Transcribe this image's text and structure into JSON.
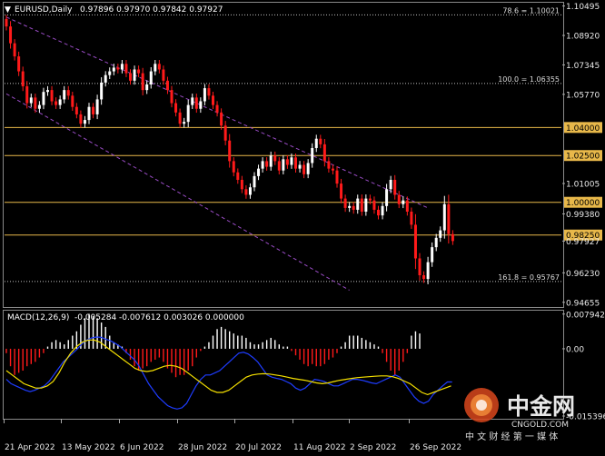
{
  "chart_data": [
    {
      "type": "candlestick",
      "symbol": "EURUSD,Daily",
      "ohlc_header": "0.97896 0.97970 0.97842 0.97927",
      "y_ticks": [
        "1.10495",
        "1.08920",
        "1.07345",
        "1.05770",
        "1.04000",
        "1.02500",
        "1.01005",
        "1.00000",
        "0.99380",
        "0.98250",
        "0.97927",
        "0.96230",
        "0.94655"
      ],
      "y_range": [
        0.9445,
        1.1062
      ],
      "x_labels": [
        "21 Apr 2022",
        "13 May 2022",
        "6 Jun 2022",
        "28 Jun 2022",
        "20 Jul 2022",
        "11 Aug 2022",
        "2 Sep 2022",
        "26 Sep 2022"
      ],
      "horizontal_levels": [
        1.04,
        1.025,
        1.0,
        0.9825
      ],
      "fib_levels": [
        {
          "label": "78.6 = 1.10021",
          "price": 1.10021
        },
        {
          "label": "100.0 = 1.06355",
          "price": 1.06355
        },
        {
          "label": "161.8 = 0.95767",
          "price": 0.95767
        }
      ],
      "channel": {
        "upper": [
          [
            0,
            1.099
          ],
          [
            102,
            0.997
          ]
        ],
        "lower": [
          [
            0,
            1.058
          ],
          [
            83,
            0.953
          ]
        ]
      },
      "closes": [
        1.094,
        1.085,
        1.078,
        1.07,
        1.062,
        1.053,
        1.056,
        1.05,
        1.052,
        1.059,
        1.06,
        1.054,
        1.052,
        1.055,
        1.06,
        1.057,
        1.051,
        1.047,
        1.042,
        1.044,
        1.051,
        1.047,
        1.055,
        1.064,
        1.068,
        1.07,
        1.072,
        1.071,
        1.074,
        1.069,
        1.065,
        1.071,
        1.069,
        1.06,
        1.063,
        1.07,
        1.074,
        1.071,
        1.065,
        1.06,
        1.053,
        1.048,
        1.042,
        1.043,
        1.052,
        1.056,
        1.05,
        1.054,
        1.061,
        1.057,
        1.052,
        1.048,
        1.041,
        1.033,
        1.022,
        1.016,
        1.012,
        1.007,
        1.004,
        1.008,
        1.014,
        1.018,
        1.022,
        1.019,
        1.025,
        1.022,
        1.017,
        1.023,
        1.02,
        1.024,
        1.018,
        1.02,
        1.015,
        1.021,
        1.029,
        1.034,
        1.031,
        1.022,
        1.018,
        1.017,
        1.01,
        1.002,
        0.997,
        0.998,
        0.996,
        1.002,
        0.995,
        1.002,
        1.001,
        0.996,
        0.993,
        0.998,
        1.007,
        1.012,
        1.004,
        0.999,
        1.001,
        0.995,
        0.988,
        0.97,
        0.961,
        0.959,
        0.968,
        0.976,
        0.981,
        0.985,
        0.999,
        0.983,
        0.9793
      ],
      "macd": {
        "label": "MACD(12,26,9)",
        "values_text": "-0.005284 -0.007612 0.003026 0.000000",
        "y_ticks": [
          "0.007942",
          "0.00",
          "-0.015396"
        ],
        "y_range": [
          -0.0154,
          0.0081
        ],
        "histogram": [
          -0.001,
          -0.004,
          -0.006,
          -0.0055,
          -0.005,
          -0.004,
          -0.0035,
          -0.003,
          -0.002,
          -0.001,
          0.0005,
          0.0015,
          0.002,
          0.0015,
          0.001,
          0.002,
          0.003,
          0.004,
          0.0055,
          0.007,
          0.008,
          0.0075,
          0.007,
          0.006,
          0.005,
          0.003,
          0.0015,
          0.001,
          0.0005,
          -0.001,
          -0.0025,
          -0.004,
          -0.005,
          -0.0045,
          -0.004,
          -0.003,
          -0.0025,
          -0.002,
          -0.003,
          -0.0045,
          -0.0055,
          -0.0065,
          -0.006,
          -0.006,
          -0.005,
          -0.004,
          -0.002,
          -0.0005,
          0.0005,
          0.0015,
          0.003,
          0.0045,
          0.005,
          0.0045,
          0.004,
          0.0035,
          0.003,
          0.003,
          0.0025,
          0.0015,
          0.001,
          0.001,
          0.0015,
          0.002,
          0.0025,
          0.002,
          0.001,
          0.0005,
          0.0005,
          -0.0005,
          -0.0015,
          -0.0025,
          -0.0035,
          -0.004,
          -0.0035,
          -0.004,
          -0.004,
          -0.0035,
          -0.0025,
          -0.002,
          -0.001,
          0.0005,
          0.0015,
          0.003,
          0.003,
          0.003,
          0.0025,
          0.002,
          0.0015,
          0.001,
          0.0005,
          -0.001,
          -0.003,
          -0.005,
          -0.006,
          -0.005,
          -0.003,
          -0.001,
          0.003,
          0.004,
          0.0035
        ],
        "main": [
          -0.007,
          -0.008,
          -0.0085,
          -0.009,
          -0.0095,
          -0.0098,
          -0.0095,
          -0.009,
          -0.0085,
          -0.0075,
          -0.006,
          -0.0045,
          -0.003,
          -0.002,
          -0.001,
          0.0,
          0.0012,
          0.002,
          0.0025,
          0.0027,
          0.0026,
          0.0022,
          0.0018,
          0.0012,
          0.0005,
          -0.0005,
          -0.0015,
          -0.0025,
          -0.004,
          -0.006,
          -0.008,
          -0.0095,
          -0.011,
          -0.012,
          -0.013,
          -0.0135,
          -0.0138,
          -0.0135,
          -0.0125,
          -0.0105,
          -0.0085,
          -0.007,
          -0.006,
          -0.006,
          -0.0055,
          -0.005,
          -0.004,
          -0.003,
          -0.002,
          -0.001,
          -0.0008,
          -0.0012,
          -0.002,
          -0.003,
          -0.0045,
          -0.006,
          -0.0065,
          -0.0068,
          -0.007,
          -0.0075,
          -0.008,
          -0.009,
          -0.0095,
          -0.009,
          -0.008,
          -0.007,
          -0.0072,
          -0.0075,
          -0.008,
          -0.0085,
          -0.0085,
          -0.008,
          -0.0075,
          -0.007,
          -0.007,
          -0.0072,
          -0.0075,
          -0.0078,
          -0.008,
          -0.0075,
          -0.007,
          -0.0065,
          -0.006,
          -0.0065,
          -0.008,
          -0.0095,
          -0.011,
          -0.012,
          -0.0125,
          -0.012,
          -0.0105,
          -0.0095,
          -0.0085,
          -0.0076,
          -0.0076
        ],
        "signal": [
          -0.005,
          -0.006,
          -0.007,
          -0.008,
          -0.0085,
          -0.009,
          -0.009,
          -0.0085,
          -0.0075,
          -0.0055,
          -0.003,
          -0.001,
          0.0005,
          0.0015,
          0.002,
          0.002,
          0.0015,
          0.0005,
          -0.0005,
          -0.0015,
          -0.0025,
          -0.0035,
          -0.0045,
          -0.005,
          -0.0052,
          -0.005,
          -0.0045,
          -0.004,
          -0.0038,
          -0.004,
          -0.0045,
          -0.0055,
          -0.0065,
          -0.0075,
          -0.0085,
          -0.0095,
          -0.01,
          -0.01,
          -0.0095,
          -0.0085,
          -0.0075,
          -0.0065,
          -0.006,
          -0.0058,
          -0.0057,
          -0.0058,
          -0.006,
          -0.0062,
          -0.0065,
          -0.0068,
          -0.007,
          -0.0072,
          -0.0075,
          -0.0078,
          -0.008,
          -0.0078,
          -0.0075,
          -0.0072,
          -0.007,
          -0.0068,
          -0.0066,
          -0.0065,
          -0.0064,
          -0.0063,
          -0.0062,
          -0.0062,
          -0.0064,
          -0.0068,
          -0.0074,
          -0.008,
          -0.009,
          -0.01,
          -0.0105,
          -0.01,
          -0.0095,
          -0.009,
          -0.0085
        ],
        "signal_color": "#f5e000",
        "main_color": "#1e3cff"
      }
    }
  ],
  "colors": {
    "bull": "#ffffff",
    "bear": "#ff1a1a",
    "level": "#e8b84a",
    "grid": "#bfbfbf",
    "channel": "#9a4cc6"
  },
  "watermark": {
    "name": "中金网",
    "url": "CNGOLD.COM",
    "tagline": "中 文 财 经 第 一 媒 体"
  }
}
